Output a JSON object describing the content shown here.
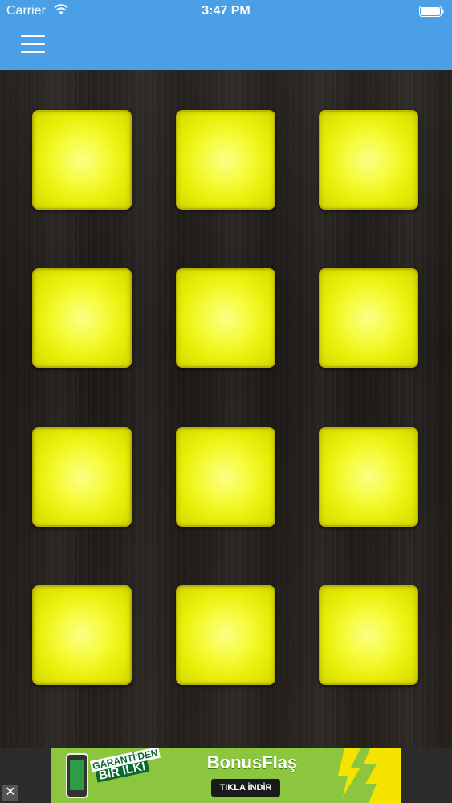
{
  "status_bar": {
    "carrier": "Carrier",
    "time": "3:47 PM",
    "icons": [
      "wifi-icon",
      "battery-icon"
    ]
  },
  "nav_bar": {
    "menu_icon": "hamburger-menu-icon",
    "color": "#4a9fe6"
  },
  "pad_grid": {
    "rows": 4,
    "columns": 3,
    "pad_color": "#f2f61e",
    "pads": [
      "pad-1",
      "pad-2",
      "pad-3",
      "pad-4",
      "pad-5",
      "pad-6",
      "pad-7",
      "pad-8",
      "pad-9",
      "pad-10",
      "pad-11",
      "pad-12"
    ]
  },
  "ad_banner": {
    "close_label": "✕",
    "tagline_line1": "GARANTİ'DEN",
    "tagline_line2": "BİR İLK!",
    "title": "BonusFlaş",
    "cta": "TIKLA İNDİR",
    "color": "#8cc63f"
  }
}
